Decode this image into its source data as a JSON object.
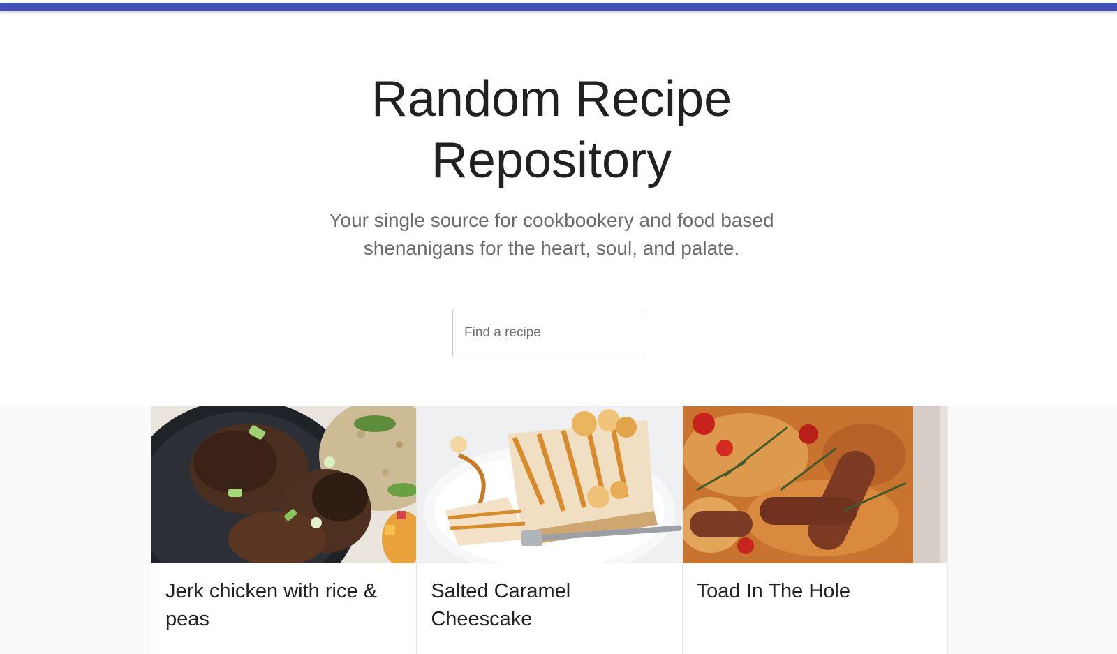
{
  "header": {
    "accent_color": "#3f51b5"
  },
  "hero": {
    "title": "Random Recipe Repository",
    "subtitle": "Your single source for cookbookery and food based shenanigans for the heart, soul, and palate."
  },
  "search": {
    "placeholder": "Find a recipe",
    "value": ""
  },
  "recipes": [
    {
      "title": "Jerk chicken with rice & peas",
      "image": "jerk-chicken-photo"
    },
    {
      "title": "Salted Caramel Cheescake",
      "image": "salted-caramel-cheesecake-photo"
    },
    {
      "title": "Toad In The Hole",
      "image": "toad-in-the-hole-photo"
    }
  ]
}
